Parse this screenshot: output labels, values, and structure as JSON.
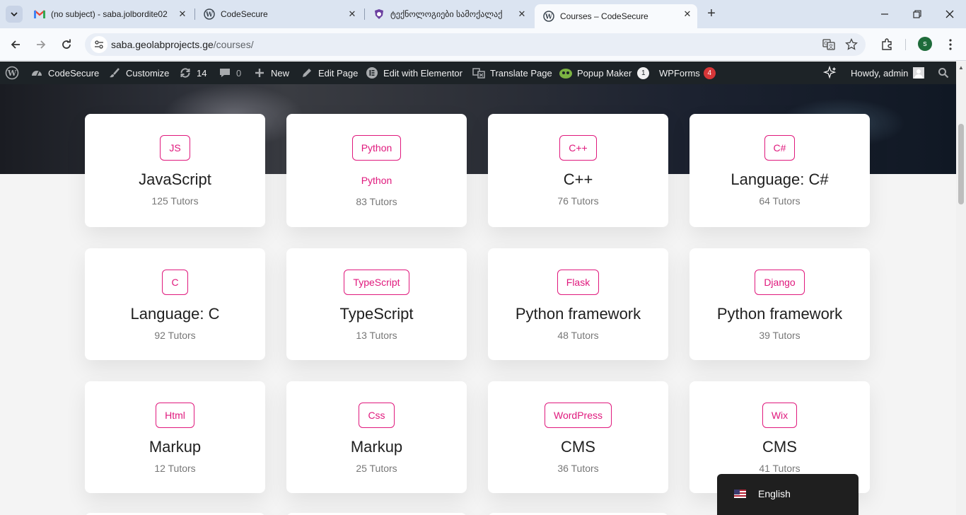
{
  "browser": {
    "tabs": [
      {
        "title": "(no subject) - saba.jolbordite02",
        "icon": "gmail-icon"
      },
      {
        "title": "CodeSecure",
        "icon": "wordpress-icon"
      },
      {
        "title": "ტექნოლოგიები სამოქალაქ",
        "icon": "shield-logo-icon"
      },
      {
        "title": "Courses – CodeSecure",
        "icon": "wordpress-icon"
      }
    ],
    "url_host": "saba.geolabprojects.ge",
    "url_path": "/courses/",
    "profile_initial": "s"
  },
  "adminbar": {
    "site": "CodeSecure",
    "customize": "Customize",
    "updates": "14",
    "comments": "0",
    "new": "New",
    "edit_page": "Edit Page",
    "elementor": "Edit with Elementor",
    "translate": "Translate Page",
    "popup_maker": "Popup Maker",
    "popup_count": "1",
    "wpforms": "WPForms",
    "wpforms_count": "4",
    "howdy": "Howdy, admin"
  },
  "courses": [
    {
      "tag": "JS",
      "title": "JavaScript",
      "tutors": "125 Tutors"
    },
    {
      "tag": "Python",
      "title": "Python",
      "tutors": "83 Tutors"
    },
    {
      "tag": "C++",
      "title": "C++",
      "tutors": "76 Tutors"
    },
    {
      "tag": "C#",
      "title": "Language: C#",
      "tutors": "64 Tutors"
    },
    {
      "tag": "C",
      "title": "Language: C",
      "tutors": "92 Tutors"
    },
    {
      "tag": "TypeScript",
      "title": "TypeScript",
      "tutors": "13 Tutors"
    },
    {
      "tag": "Flask",
      "title": "Python framework",
      "tutors": "48 Tutors"
    },
    {
      "tag": "Django",
      "title": "Python framework",
      "tutors": "39 Tutors"
    },
    {
      "tag": "Html",
      "title": "Markup",
      "tutors": "12 Tutors"
    },
    {
      "tag": "Css",
      "title": "Markup",
      "tutors": "25 Tutors"
    },
    {
      "tag": "WordPress",
      "title": "CMS",
      "tutors": "36 Tutors"
    },
    {
      "tag": "Wix",
      "title": "CMS",
      "tutors": "41 Tutors"
    }
  ],
  "language": {
    "label": "English",
    "flag": "us-flag-icon"
  },
  "colors": {
    "accent": "#e0197d",
    "adminbar": "#1d2327",
    "badge_red": "#d63638"
  }
}
